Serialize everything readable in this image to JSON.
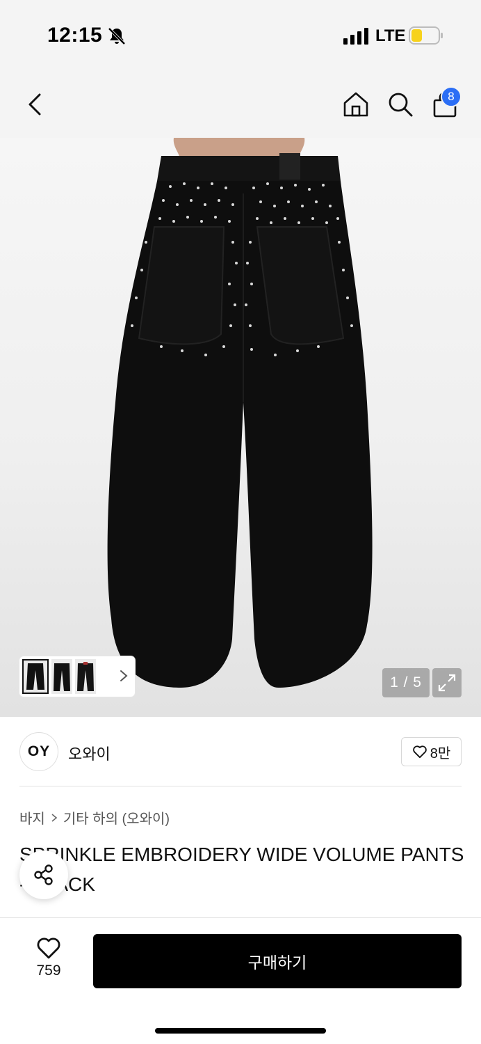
{
  "status_bar": {
    "time": "12:15",
    "carrier": "LTE"
  },
  "nav": {
    "cart_count": "8"
  },
  "gallery": {
    "page_indicator": "1 / 5",
    "thumbnail_count": 3
  },
  "brand": {
    "logo_text": "OY",
    "name": "오와이",
    "like_count": "8만"
  },
  "breadcrumb": {
    "category": "바지",
    "subcategory": "기타 하의 (오와이)"
  },
  "product": {
    "title": "SPRINKLE EMBROIDERY WIDE VOLUME PANTS - BLACK"
  },
  "bottom": {
    "wish_count": "759",
    "buy_label": "구매하기"
  },
  "colors": {
    "accent_badge": "#2b6ef5",
    "buy_button": "#000000"
  },
  "icons": [
    "back-icon",
    "home-icon",
    "search-icon",
    "bag-icon",
    "heart-icon",
    "share-icon",
    "expand-icon",
    "chevron-right-icon",
    "bell-off-icon",
    "signal-icon",
    "battery-icon"
  ]
}
